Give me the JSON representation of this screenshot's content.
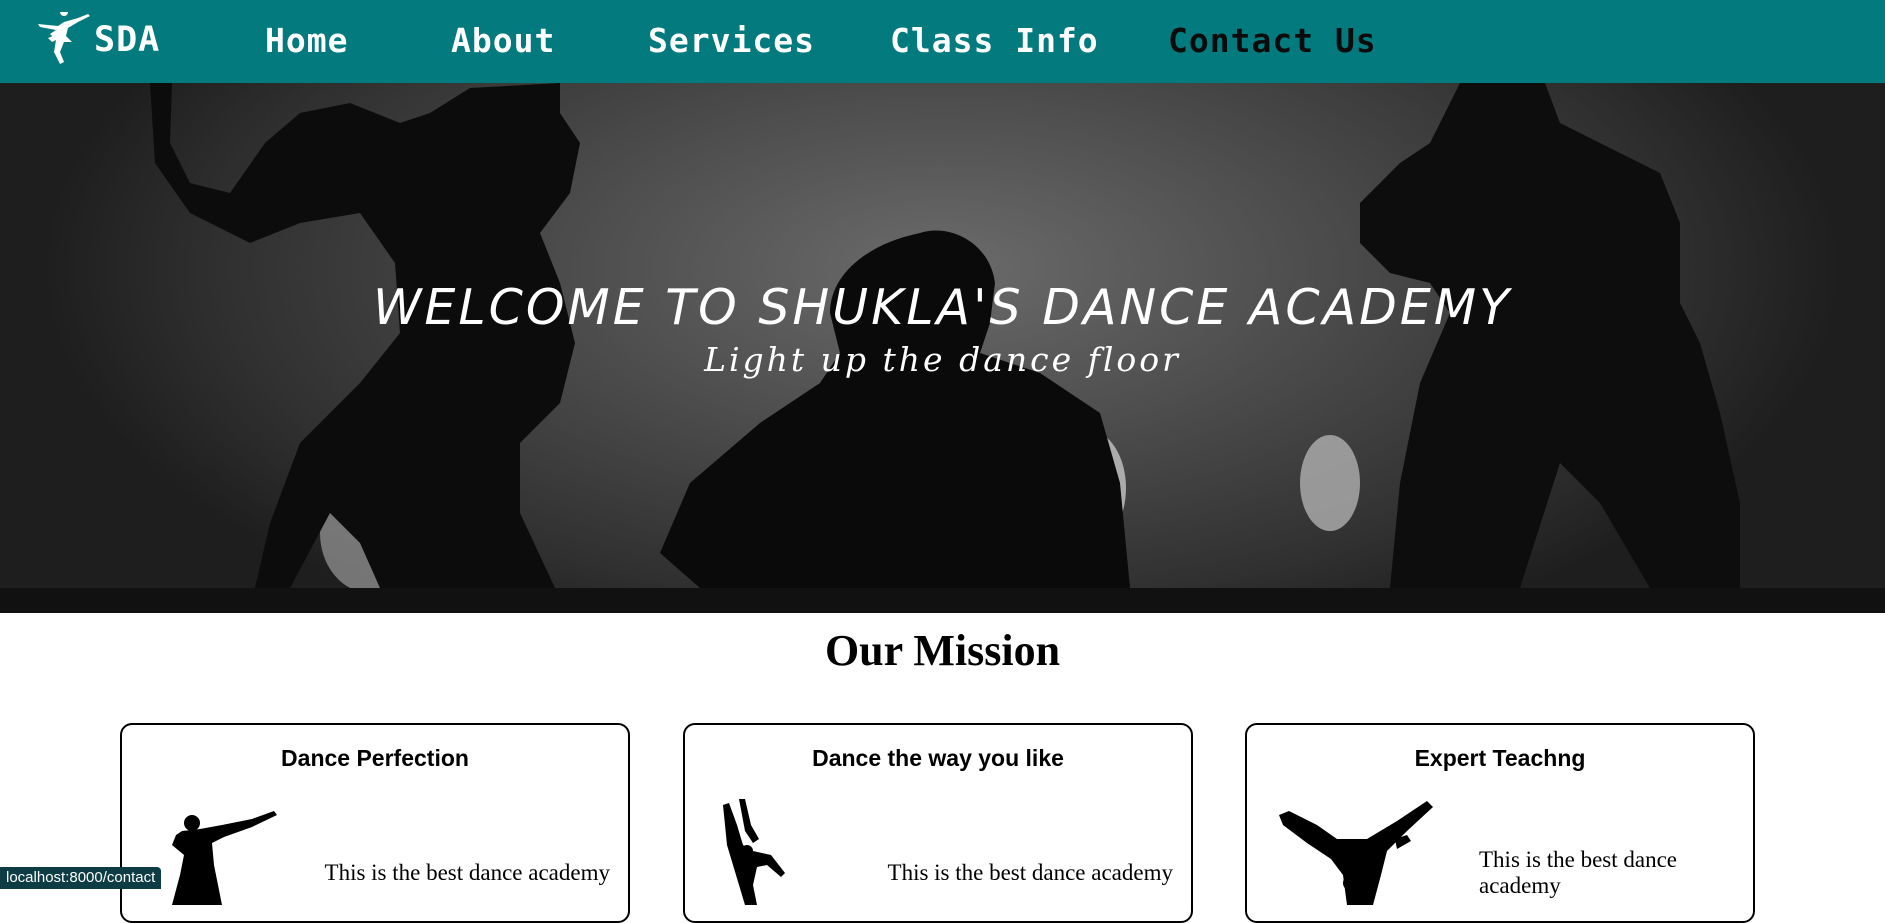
{
  "nav": {
    "logo_text": "SDA",
    "items": [
      {
        "label": "Home"
      },
      {
        "label": "About"
      },
      {
        "label": "Services"
      },
      {
        "label": "Class Info"
      },
      {
        "label": "Contact Us"
      }
    ],
    "active_index": 4,
    "background_color": "#037a7d"
  },
  "hero": {
    "title": "Welcome to Shukla's Dance Academy",
    "subtitle": "Light up the dance floor"
  },
  "mission": {
    "title": "Our Mission",
    "cards": [
      {
        "title": "Dance Perfection",
        "text": "This is the best dance academy",
        "icon": "hip-hop-dancer-silhouette"
      },
      {
        "title": "Dance the way you like",
        "text": "This is the best dance academy",
        "icon": "ballet-pair-silhouette"
      },
      {
        "title": "Expert Teachng",
        "text": "This is the best dance academy",
        "icon": "breakdancer-silhouette"
      }
    ]
  },
  "status": {
    "url": "localhost:8000/contact"
  }
}
